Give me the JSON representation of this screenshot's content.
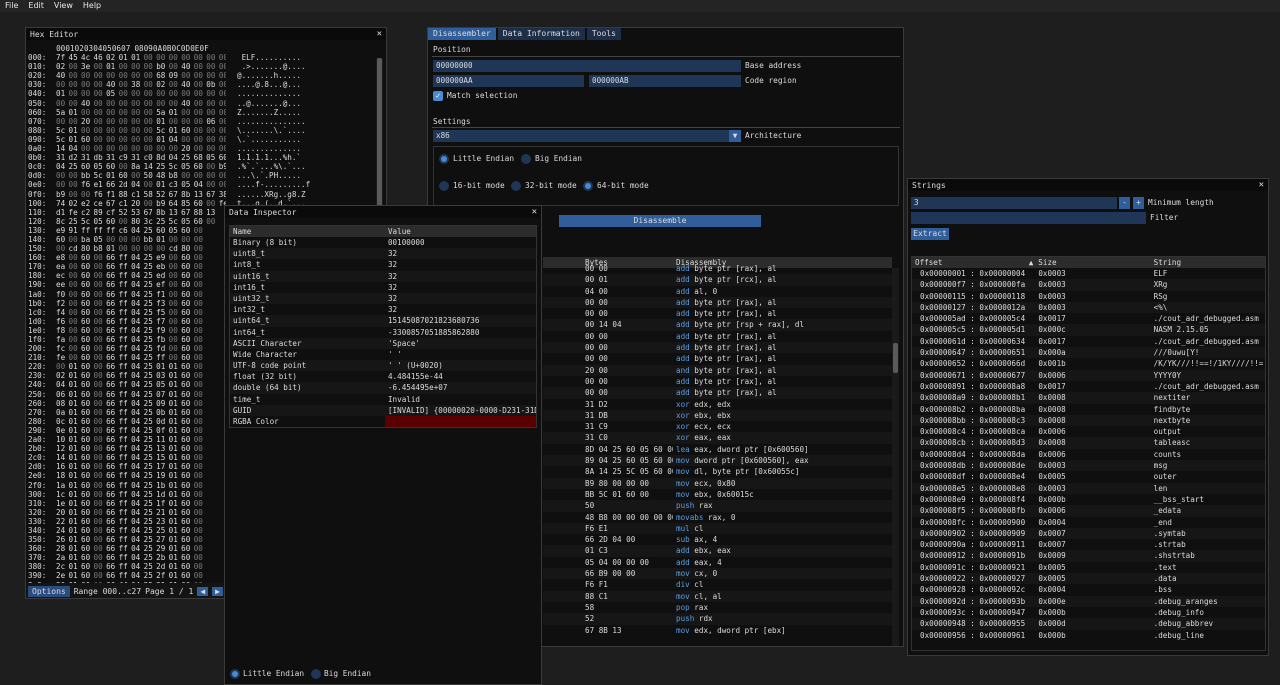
{
  "menu": {
    "file": "File",
    "edit": "Edit",
    "view": "View",
    "help": "Help"
  },
  "hex": {
    "title": "Hex Editor",
    "header_bytes": [
      "00",
      "01",
      "02",
      "03",
      "04",
      "05",
      "06",
      "07",
      "08",
      "09",
      "0A",
      "0B",
      "0C",
      "0D",
      "0E",
      "0F"
    ],
    "rows": [
      [
        "000:",
        "7f 45 4c 46 02 01 01 00 00 00 00 00 00 00 00 00",
        " ELF.........."
      ],
      [
        "010:",
        "02 00 3e 00 01 00 00 00 b0 00 40 00 00 00 00 00",
        " .>.......@...."
      ],
      [
        "020:",
        "40 00 00 00 00 00 00 00 68 09 00 00 00 00 00 00",
        "@.......h....."
      ],
      [
        "030:",
        "00 00 00 00 40 00 38 00 02 00 40 00 0b 00 08 00",
        "....@.8...@..."
      ],
      [
        "040:",
        "01 00 00 00 05 00 00 00 00 00 00 00 00 00 00 00",
        ".............."
      ],
      [
        "050:",
        "00 00 40 00 00 00 00 00 00 00 40 00 00 00 00 00",
        "..@.......@..."
      ],
      [
        "060:",
        "5a 01 00 00 00 00 00 00 5a 01 00 00 00 00 00 00",
        "Z.......Z....."
      ],
      [
        "070:",
        "00 00 20 00 00 00 00 00 01 00 00 00 06 00 00 00",
        "..............."
      ],
      [
        "080:",
        "5c 01 00 00 00 00 00 00 5c 01 60 00 00 00 00 00",
        "\\.......\\.`...."
      ],
      [
        "090:",
        "5c 01 60 00 00 00 00 00 01 04 00 00 00 00 00 00",
        "\\.`..........."
      ],
      [
        "0a0:",
        "14 04 00 00 00 00 00 00 00 00 20 00 00 00 00 00",
        ".............."
      ],
      [
        "0b0:",
        "31 d2 31 db 31 c9 31 c0 8d 04 25 68 05 60 00 89",
        "1.1.1.1...%h.`"
      ],
      [
        "0c0:",
        "04 25 60 05 60 00 8a 14 25 5c 05 60 00 b9 80 00",
        ".%`.`...%\\.`..."
      ],
      [
        "0d0:",
        "00 00 bb 5c 01 60 00 50 48 b8 00 00 00 00 00 00",
        "...\\.`.PH....."
      ],
      [
        "0e0:",
        "00 00 f6 e1 66 2d 04 00 01 c3 05 04 00 00 00 66",
        "....f-.........f"
      ],
      [
        "0f0:",
        "b9 00 00 f6 f1 88 c1 58 52 67 8b 13 67 38 10 5a",
        "......XRg..g8.Z"
      ],
      [
        "100:",
        "74 02 e2 ce 67 c1 20 00 b9 64 85 60 00 fe ca 00",
        "t...g.(..d.`..."
      ],
      [
        "110:",
        "d1 fe c2 89 cf 52 53 67 8b 13 67 88 13",
        "....RSg..g..."
      ],
      [
        "120:",
        "8c 25 5c 05 60 00 80 3c 25 5c 05 60 00",
        ".%\\.`..<%\\.`."
      ],
      [
        "130:",
        "e9 91 ff ff ff c6 04 25 60 05 60 00",
        "......%`.`."
      ],
      [
        "140:",
        "60 00 ba 05 00 00 00 bb 01 00 00 00",
        "`..........."
      ],
      [
        "150:",
        "00 cd 80 b8 01 00 00 00 00 cd 80 00",
        "............"
      ],
      [
        "160:",
        "e8 00 60 00 66 ff 04 25 e9 00 60 00",
        "..`.f..%..`."
      ],
      [
        "170:",
        "ea 00 60 00 66 ff 04 25 eb 00 60 00",
        "..`.f..%..`."
      ],
      [
        "180:",
        "ec 00 60 00 66 ff 04 25 ed 00 60 00",
        "..`.f..%..`."
      ],
      [
        "190:",
        "ee 00 60 00 66 ff 04 25 ef 00 60 00",
        "..`.f..%..`."
      ],
      [
        "1a0:",
        "f0 00 60 00 66 ff 04 25 f1 00 60 00",
        "..`.f..%..`."
      ],
      [
        "1b0:",
        "f2 00 60 00 66 ff 04 25 f3 00 60 00",
        "..`.f..%..`."
      ],
      [
        "1c0:",
        "f4 00 60 00 66 ff 04 25 f5 00 60 00",
        "..`.f..%..`."
      ],
      [
        "1d0:",
        "f6 00 60 00 66 ff 04 25 f7 00 60 00",
        "..`.f..%..`."
      ],
      [
        "1e0:",
        "f8 00 60 00 66 ff 04 25 f9 00 60 00",
        "..`.f..%..`."
      ],
      [
        "1f0:",
        "fa 00 60 00 66 ff 04 25 fb 00 60 00",
        "..`.f..%..`."
      ],
      [
        "200:",
        "fc 00 60 00 66 ff 04 25 fd 00 60 00",
        "..`.f..%..`."
      ],
      [
        "210:",
        "fe 00 60 00 66 ff 04 25 ff 00 60 00",
        "..`.f..%..`."
      ],
      [
        "220:",
        "00 01 60 00 66 ff 04 25 01 01 60 00",
        "..`.f..%..`."
      ],
      [
        "230:",
        "02 01 60 00 66 ff 04 25 03 01 60 00",
        "..`.f..%..`."
      ],
      [
        "240:",
        "04 01 60 00 66 ff 04 25 05 01 60 00",
        "..`.f..%..`."
      ],
      [
        "250:",
        "06 01 60 00 66 ff 04 25 07 01 60 00",
        "..`.f..%..`."
      ],
      [
        "260:",
        "08 01 60 00 66 ff 04 25 09 01 60 00",
        "..`.f..%..`."
      ],
      [
        "270:",
        "0a 01 60 00 66 ff 04 25 0b 01 60 00",
        "..`.f..%..`."
      ],
      [
        "280:",
        "0c 01 60 00 66 ff 04 25 0d 01 60 00",
        "..`.f..%..`."
      ],
      [
        "290:",
        "0e 01 60 00 66 ff 04 25 0f 01 60 00",
        "..`.f..%..`."
      ],
      [
        "2a0:",
        "10 01 60 00 66 ff 04 25 11 01 60 00",
        "..`.f..%..`."
      ],
      [
        "2b0:",
        "12 01 60 00 66 ff 04 25 13 01 60 00",
        "..`.f..%..`."
      ],
      [
        "2c0:",
        "14 01 60 00 66 ff 04 25 15 01 60 00",
        "..`.f..%..`."
      ],
      [
        "2d0:",
        "16 01 60 00 66 ff 04 25 17 01 60 00",
        "..`.f..%..`."
      ],
      [
        "2e0:",
        "18 01 60 00 66 ff 04 25 19 01 60 00",
        "..`.f..%..`."
      ],
      [
        "2f0:",
        "1a 01 60 00 66 ff 04 25 1b 01 60 00",
        "..`.f..%..`."
      ],
      [
        "300:",
        "1c 01 60 00 66 ff 04 25 1d 01 60 00",
        "..`.f..%..`."
      ],
      [
        "310:",
        "1e 01 60 00 66 ff 04 25 1f 01 60 00",
        "..`.f..%..`."
      ],
      [
        "320:",
        "20 01 60 00 66 ff 04 25 21 01 60 00",
        "..`.f..%!.`."
      ],
      [
        "330:",
        "22 01 60 00 66 ff 04 25 23 01 60 00",
        "\".`.f..%#.`."
      ],
      [
        "340:",
        "24 01 60 00 66 ff 04 25 25 01 60 00",
        "$.`.f..%%.`."
      ],
      [
        "350:",
        "26 01 60 00 66 ff 04 25 27 01 60 00",
        "&.`.f..%'.`."
      ],
      [
        "360:",
        "28 01 60 00 66 ff 04 25 29 01 60 00",
        "(.`.f..%).`."
      ],
      [
        "370:",
        "2a 01 60 00 66 ff 04 25 2b 01 60 00",
        "*.`.f..%+.`."
      ],
      [
        "380:",
        "2c 01 60 00 66 ff 04 25 2d 01 60 00",
        ",.`.f..%-.`."
      ],
      [
        "390:",
        "2e 01 60 00 66 ff 04 25 2f 01 60 00",
        "..`.f..%/.`."
      ],
      [
        "3a0:",
        "30 01 60 00 66 ff 04 25 31 01 60 00",
        "0.`.f..%1.`."
      ],
      [
        "3b0:",
        "32 01 60 00 66 ff 04 25 33 01 60 00",
        "2.`.f..%3.`."
      ]
    ],
    "footer": {
      "options": "Options",
      "range": "Range 000..c27",
      "page": "Page 1 / 1"
    }
  },
  "inspector": {
    "title": "Data Inspector",
    "col_name": "Name",
    "col_value": "Value",
    "rows": [
      [
        "Binary (8 bit)",
        "00100000"
      ],
      [
        "uint8_t",
        "32"
      ],
      [
        "int8_t",
        "32"
      ],
      [
        "uint16_t",
        "32"
      ],
      [
        "int16_t",
        "32"
      ],
      [
        "uint32_t",
        "32"
      ],
      [
        "int32_t",
        "32"
      ],
      [
        "uint64_t",
        "15145087021823680736"
      ],
      [
        "int64_t",
        "-3300857051885862880"
      ],
      [
        "ASCII Character",
        "'Space'"
      ],
      [
        "Wide Character",
        "' '"
      ],
      [
        "UTF-8 code point",
        "' ' (U+0020)"
      ],
      [
        "float (32 bit)",
        "4.484155e-44"
      ],
      [
        "double (64 bit)",
        "-6.454495e+07"
      ],
      [
        "time_t",
        "Invalid"
      ],
      [
        "GUID",
        "[INVALID] {00000020-0000-D231-31D"
      ],
      [
        "RGBA Color",
        ""
      ]
    ],
    "little": "Little Endian",
    "big": "Big Endian",
    "rgba_color": "#5a0000"
  },
  "disasm": {
    "tabs": [
      "Disassembler",
      "Data Information",
      "Tools"
    ],
    "position": "Position",
    "base_value": "00000000",
    "base_label": "Base address",
    "region_start": "000000AA",
    "region_end": "000000AB",
    "region_label": "Code region",
    "match": "Match selection",
    "settings": "Settings",
    "arch_value": "x86",
    "arch_label": "Architecture",
    "little": "Little Endian",
    "big": "Big Endian",
    "m16": "16-bit mode",
    "m32": "32-bit mode",
    "m64": "64-bit mode",
    "button": "Disassemble",
    "col_bytes": "Bytes",
    "col_dis": "Disassembly",
    "rows": [
      [
        "00 00",
        "add",
        "byte ptr [rax], al"
      ],
      [
        "00 01",
        "add",
        "byte ptr [rcx], al"
      ],
      [
        "04 00",
        "add",
        "al, 0"
      ],
      [
        "00 00",
        "add",
        "byte ptr [rax], al"
      ],
      [
        "00 00",
        "add",
        "byte ptr [rax], al"
      ],
      [
        "00 14 04",
        "add",
        "byte ptr [rsp + rax], dl"
      ],
      [
        "00 00",
        "add",
        "byte ptr [rax], al"
      ],
      [
        "00 00",
        "add",
        "byte ptr [rax], al"
      ],
      [
        "00 00",
        "add",
        "byte ptr [rax], al"
      ],
      [
        "20 00",
        "and",
        "byte ptr [rax], al"
      ],
      [
        "00 00",
        "add",
        "byte ptr [rax], al"
      ],
      [
        "00 00",
        "add",
        "byte ptr [rax], al"
      ],
      [
        "31 D2",
        "xor",
        "edx, edx"
      ],
      [
        "31 DB",
        "xor",
        "ebx, ebx"
      ],
      [
        "31 C9",
        "xor",
        "ecx, ecx"
      ],
      [
        "31 C0",
        "xor",
        "eax, eax"
      ],
      [
        "8D 04 25 60 05 60 00",
        "lea",
        "eax, dword ptr [0x600560]"
      ],
      [
        "89 04 25 60 05 60 00",
        "mov",
        "dword ptr [0x600560], eax"
      ],
      [
        "8A 14 25 5C 05 60 00",
        "mov",
        "dl, byte ptr [0x60055c]"
      ],
      [
        "B9 80 00 00 00",
        "mov",
        "ecx, 0x80"
      ],
      [
        "BB 5C 01 60 00",
        "mov",
        "ebx, 0x60015c"
      ],
      [
        "50",
        "push",
        "rax"
      ],
      [
        "48 B8 00 00 00 00 00 00 00 00",
        "movabs",
        "rax, 0"
      ],
      [
        "F6 E1",
        "mul",
        "cl"
      ],
      [
        "66 2D 04 00",
        "sub",
        "ax, 4"
      ],
      [
        "01 C3",
        "add",
        "ebx, eax"
      ],
      [
        "05 04 00 00 00",
        "add",
        "eax, 4"
      ],
      [
        "66 B9 00 00",
        "mov",
        "cx, 0"
      ],
      [
        "F6 F1",
        "div",
        "cl"
      ],
      [
        "88 C1",
        "mov",
        "cl, al"
      ],
      [
        "58",
        "pop",
        "rax"
      ],
      [
        "52",
        "push",
        "rdx"
      ],
      [
        "67 8B 13",
        "mov",
        "edx, dword ptr [ebx]"
      ]
    ]
  },
  "strings": {
    "title": "Strings",
    "min_value": "3",
    "min_label": "Minimum length",
    "minus": "-",
    "plus": "+",
    "filter_label": "Filter",
    "extract": "Extract",
    "col_offset": "Offset",
    "col_size": "Size",
    "col_string": "String",
    "rows": [
      [
        "0x00000001 : 0x00000004",
        "0x0003",
        "ELF"
      ],
      [
        "0x000000f7 : 0x000000fa",
        "0x0003",
        "XRg"
      ],
      [
        "0x00000115 : 0x00000118",
        "0x0003",
        "RSg"
      ],
      [
        "0x00000127 : 0x0000012a",
        "0x0003",
        "<%\\"
      ],
      [
        "0x000005ad : 0x000005c4",
        "0x0017",
        "./cout_adr_debugged.asm"
      ],
      [
        "0x000005c5 : 0x000005d1",
        "0x000c",
        "NASM 2.15.05"
      ],
      [
        "0x0000061d : 0x00000634",
        "0x0017",
        "./cout_adr_debugged.asm"
      ],
      [
        "0x00000647 : 0x00000651",
        "0x000a",
        "///0uwu[Y!"
      ],
      [
        "0x00000652 : 0x0000066d",
        "0x001b",
        "/K/YK///!!==!/1KY////!!="
      ],
      [
        "0x00000671 : 0x00000677",
        "0x0006",
        "YYYY0Y"
      ],
      [
        "0x00000891 : 0x000008a8",
        "0x0017",
        "./cout_adr_debugged.asm"
      ],
      [
        "0x000008a9 : 0x000008b1",
        "0x0008",
        "nextiter"
      ],
      [
        "0x000008b2 : 0x000008ba",
        "0x0008",
        "findbyte"
      ],
      [
        "0x000008bb : 0x000008c3",
        "0x0008",
        "nextbyte"
      ],
      [
        "0x000008c4 : 0x000008ca",
        "0x0006",
        "output"
      ],
      [
        "0x000008cb : 0x000008d3",
        "0x0008",
        "tableasc"
      ],
      [
        "0x000008d4 : 0x000008da",
        "0x0006",
        "counts"
      ],
      [
        "0x000008db : 0x000008de",
        "0x0003",
        "msg"
      ],
      [
        "0x000008df : 0x000008e4",
        "0x0005",
        "outer"
      ],
      [
        "0x000008e5 : 0x000008e8",
        "0x0003",
        "len"
      ],
      [
        "0x000008e9 : 0x000008f4",
        "0x000b",
        "__bss_start"
      ],
      [
        "0x000008f5 : 0x000008fb",
        "0x0006",
        "_edata"
      ],
      [
        "0x000008fc : 0x00000900",
        "0x0004",
        "_end"
      ],
      [
        "0x00000902 : 0x00000909",
        "0x0007",
        ".symtab"
      ],
      [
        "0x0000090a : 0x00000911",
        "0x0007",
        ".strtab"
      ],
      [
        "0x00000912 : 0x0000091b",
        "0x0009",
        ".shstrtab"
      ],
      [
        "0x0000091c : 0x00000921",
        "0x0005",
        ".text"
      ],
      [
        "0x00000922 : 0x00000927",
        "0x0005",
        ".data"
      ],
      [
        "0x00000928 : 0x0000092c",
        "0x0004",
        ".bss"
      ],
      [
        "0x0000092d : 0x0000093b",
        "0x000e",
        ".debug_aranges"
      ],
      [
        "0x0000093c : 0x00000947",
        "0x000b",
        ".debug_info"
      ],
      [
        "0x00000948 : 0x00000955",
        "0x000d",
        ".debug_abbrev"
      ],
      [
        "0x00000956 : 0x00000961",
        "0x000b",
        ".debug_line"
      ]
    ]
  }
}
